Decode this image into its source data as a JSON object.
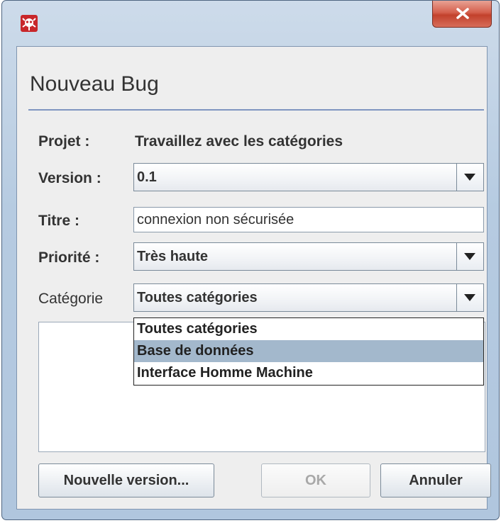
{
  "window": {
    "app_icon": "bug-icon",
    "close_icon": "close-icon"
  },
  "dialog": {
    "title": "Nouveau Bug"
  },
  "form": {
    "project_label": "Projet :",
    "project_value": "Travaillez avec les catégories",
    "version_label": "Version :",
    "version_value": "0.1",
    "title_label": "Titre :",
    "title_value": "connexion non sécurisée",
    "priority_label": "Priorité :",
    "priority_value": "Très haute",
    "category_label": "Catégorie",
    "category_value": "Toutes catégories"
  },
  "category_dropdown": {
    "options": [
      "Toutes catégories",
      "Base de données",
      "Interface Homme Machine"
    ],
    "highlighted_index": 1,
    "highlight_color": "#a3b8cc"
  },
  "footer": {
    "new_version_label": "Nouvelle version...",
    "ok_label": "OK",
    "ok_enabled": false,
    "cancel_label": "Annuler"
  },
  "colors": {
    "window_frame": "#b6cbe1",
    "close_button": "#c2412c",
    "dialog_bg": "#eeeeee",
    "title_rule": "#7f95c0"
  }
}
